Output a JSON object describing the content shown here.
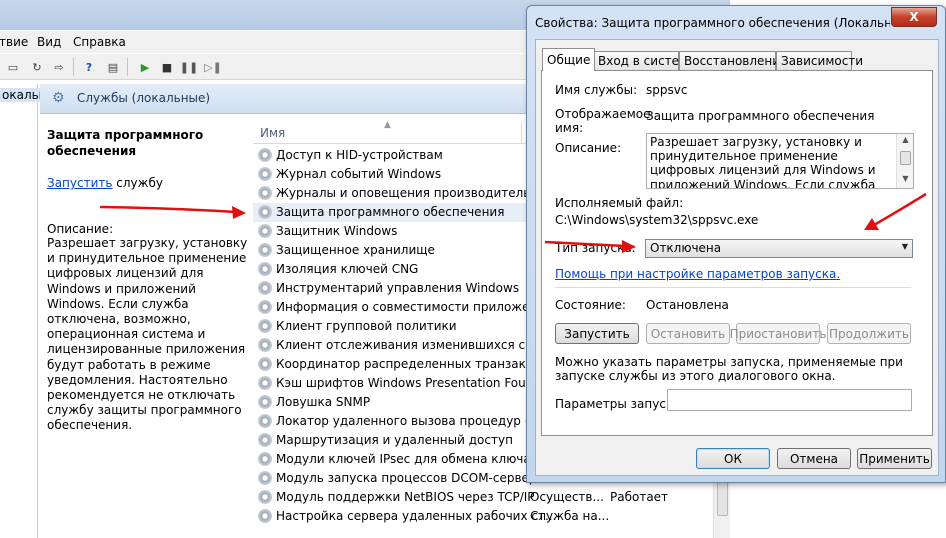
{
  "menu": {
    "items": [
      "твие",
      "Вид",
      "Справка"
    ]
  },
  "tree": {
    "label": "окальны"
  },
  "services_header": {
    "title": "Службы (локальные)"
  },
  "description_panel": {
    "title": "Защита программного обеспечения",
    "start_link": "Запустить",
    "start_suffix": " службу",
    "desc_label": "Описание:",
    "desc_text": "Разрешает загрузку, установку и принудительное применение цифровых лицензий для Windows и приложений Windows. Если служба отключена, возможно, операционная система и лицензированные приложения будут работать в режиме уведомления. Настоятельно рекомендуется не отключать службу защиты программного обеспечения."
  },
  "list": {
    "column_name": "Имя",
    "rows": [
      {
        "name": "Доступ к HID-устройствам"
      },
      {
        "name": "Журнал событий Windows"
      },
      {
        "name": "Журналы и оповещения производительн..."
      },
      {
        "name": "Защита программного обеспечения"
      },
      {
        "name": "Защитник Windows"
      },
      {
        "name": "Защищенное хранилище"
      },
      {
        "name": "Изоляция ключей CNG"
      },
      {
        "name": "Инструментарий управления Windows"
      },
      {
        "name": "Информация о совместимости приложен..."
      },
      {
        "name": "Клиент групповой политики"
      },
      {
        "name": "Клиент отслеживания изменившихся связей"
      },
      {
        "name": "Координатор распределенных транзакций"
      },
      {
        "name": "Кэш шрифтов Windows Presentation Foun..."
      },
      {
        "name": "Ловушка SNMP"
      },
      {
        "name": "Локатор удаленного вызова процедур (RPC)"
      },
      {
        "name": "Маршрутизация и удаленный доступ"
      },
      {
        "name": "Модули ключей IPsec для обмена ключам..."
      },
      {
        "name": "Модуль запуска процессов DCOM-сервера"
      },
      {
        "name": "Модуль поддержки NetBIOS через TCP/IP",
        "desc": "Осуществ...",
        "state": "Работает"
      },
      {
        "name": "Настройка сервера удаленных рабочих ст...",
        "desc": "Служба на..."
      }
    ]
  },
  "dialog": {
    "title": "Свойства: Защита программного обеспечения (Локальный ко...",
    "close_label": "X",
    "tabs": [
      "Общие",
      "Вход в систему",
      "Восстановление",
      "Зависимости"
    ],
    "service_name_label": "Имя службы:",
    "service_name": "sppsvc",
    "display_name_label_1": "Отображаемое",
    "display_name_label_2": "имя:",
    "display_name": "Защита программного обеспечения",
    "description_label": "Описание:",
    "description": "Разрешает загрузку, установку и принудительное применение цифровых лицензий для Windows и приложений Windows. Если служба отключена, возможно,",
    "exe_label": "Исполняемый файл:",
    "exe_path": "C:\\Windows\\system32\\sppsvc.exe",
    "startup_type_label": "Тип запуска:",
    "startup_type": "Отключена",
    "help_link": "Помощь при настройке параметров запуска.",
    "state_label": "Состояние:",
    "state": "Остановлена",
    "buttons": {
      "start": "Запустить",
      "stop": "Остановить",
      "pause": "Приостановить",
      "resume": "Продолжить"
    },
    "params_text": "Можно указать параметры запуска, применяемые при запуске службы из этого диалогового окна.",
    "params_label": "Параметры запуска:",
    "params_value": "",
    "footer": {
      "ok": "ОК",
      "cancel": "Отмена",
      "apply": "Применить"
    }
  },
  "colors": {
    "annotation_arrow": "#e01010",
    "link": "#0645c8"
  }
}
